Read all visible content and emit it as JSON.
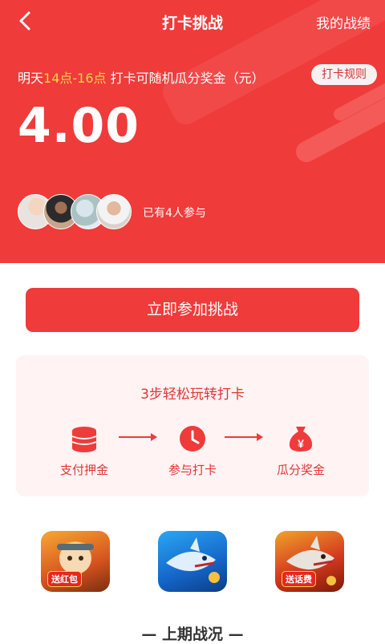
{
  "topbar": {
    "back_icon": "chevron-left-icon",
    "title": "打卡挑战",
    "records_link": "我的战绩"
  },
  "challenge": {
    "info_prefix": "明天",
    "time_window": "14点-16点",
    "info_suffix": " 打卡可随机瓜分奖金（元）",
    "rules_button": "打卡规则",
    "amount": "4.00",
    "participants_text": "已有4人参与",
    "avatar_count": 4
  },
  "actions": {
    "join_button": "立即参加挑战"
  },
  "steps": {
    "title": "3步轻松玩转打卡",
    "items": [
      {
        "label": "支付押金",
        "icon": "coin-stack-icon"
      },
      {
        "label": "参与打卡",
        "icon": "clock-icon"
      },
      {
        "label": "瓜分奖金",
        "icon": "money-bag-icon"
      }
    ]
  },
  "games": [
    {
      "badge": "送红包"
    },
    {
      "badge": ""
    },
    {
      "badge": "送话费"
    }
  ],
  "section": {
    "title": "— 上期战况 —"
  },
  "colors": {
    "primary": "#ef3b3a",
    "highlight": "#ffd24d",
    "card_bg": "#fff3f3",
    "step_text": "#e23535"
  }
}
